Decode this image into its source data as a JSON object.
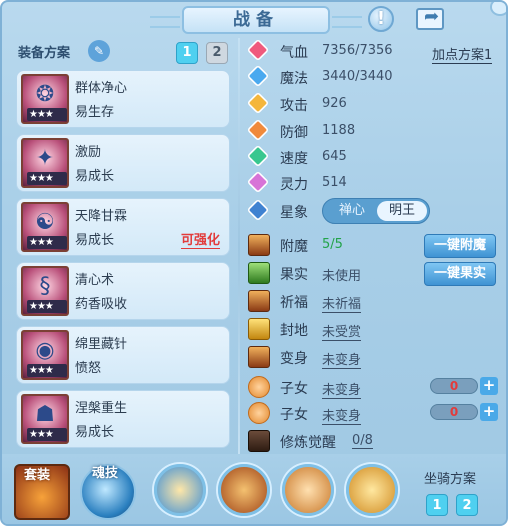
{
  "header": {
    "title": "战备",
    "help_icon": "exclamation-icon",
    "share_icon": "share-icon"
  },
  "equipment": {
    "label": "装备方案",
    "plans": [
      "1",
      "2"
    ],
    "active_plan": "1"
  },
  "skills": [
    {
      "name": "群体净心",
      "desc": "易生存",
      "stars": "★★★",
      "tag": ""
    },
    {
      "name": "激励",
      "desc": "易成长",
      "stars": "★★★",
      "tag": ""
    },
    {
      "name": "天降甘霖",
      "desc": "易成长",
      "stars": "★★★",
      "tag": "可强化"
    },
    {
      "name": "清心术",
      "desc": "药香吸收",
      "stars": "★★★",
      "tag": ""
    },
    {
      "name": "绵里藏针",
      "desc": "愤怒",
      "stars": "★★★",
      "tag": ""
    },
    {
      "name": "涅槃重生",
      "desc": "易成长",
      "stars": "★★★",
      "tag": ""
    }
  ],
  "stats": {
    "hp": {
      "label": "气血",
      "value": "7356/7356"
    },
    "mp": {
      "label": "魔法",
      "value": "3440/3440"
    },
    "atk": {
      "label": "攻击",
      "value": "926"
    },
    "def": {
      "label": "防御",
      "value": "1188"
    },
    "spd": {
      "label": "速度",
      "value": "645"
    },
    "spi": {
      "label": "灵力",
      "value": "514"
    },
    "xing": {
      "label": "星象",
      "options": [
        "禅心",
        "明王"
      ],
      "selected": "明王"
    }
  },
  "addpoint_plan": "加点方案1",
  "extras": [
    {
      "label": "附魔",
      "value": "5/5"
    },
    {
      "label": "果实",
      "value": "未使用"
    },
    {
      "label": "祈福",
      "value": "未祈福"
    },
    {
      "label": "封地",
      "value": "未受赏"
    },
    {
      "label": "变身",
      "value": "未变身"
    },
    {
      "label": "子女",
      "value": "未变身"
    },
    {
      "label": "子女",
      "value": "未变身"
    },
    {
      "label": "修炼觉醒",
      "value": "0/8"
    }
  ],
  "buttons": {
    "enchant_all": "一键附魔",
    "fruit_all": "一键果实"
  },
  "counters": [
    "0",
    "0"
  ],
  "bottom": {
    "suit_label": "套装",
    "soul_label": "魂技",
    "mount_label": "坐骑方案",
    "mount_plans": [
      "1",
      "2"
    ]
  },
  "colors": {
    "accent": "#4fd0f0",
    "highlight_red": "#e23b3b",
    "green_value": "#22a34a"
  }
}
